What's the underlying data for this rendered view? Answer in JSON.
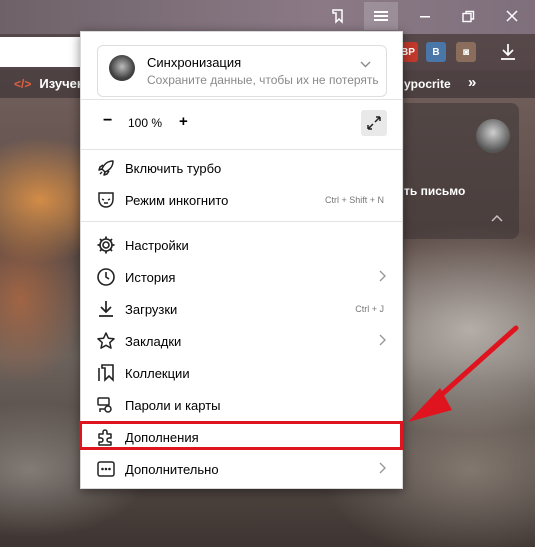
{
  "toolbar": {
    "collections_icon": "collections-icon",
    "menu_icon": "hamburger-menu-icon",
    "minimize_icon": "minimize-icon",
    "restore_icon": "restore-icon",
    "close_icon": "close-icon"
  },
  "extensions": [
    {
      "label": "BP",
      "color": "#c0392b"
    },
    {
      "label": "B",
      "color": "#4a76a8"
    },
    {
      "label": "◙",
      "color": "#8a6d5a"
    }
  ],
  "bookmarks_bar": {
    "left_label": "Изучен",
    "right_label": "ypocrite",
    "more": "»"
  },
  "side_card": {
    "mail_text": "ть письмо"
  },
  "menu": {
    "sync": {
      "title": "Синхронизация",
      "subtitle": "Сохраните данные, чтобы их не потерять"
    },
    "zoom": {
      "minus": "−",
      "value": "100 %",
      "plus": "+"
    },
    "items": [
      {
        "label": "Включить турбо",
        "icon": "rocket-icon"
      },
      {
        "label": "Режим инкогнито",
        "icon": "incognito-mask-icon",
        "shortcut": "Ctrl + Shift + N"
      },
      {
        "label": "Настройки",
        "icon": "gear-icon"
      },
      {
        "label": "История",
        "icon": "clock-icon",
        "submenu": true
      },
      {
        "label": "Загрузки",
        "icon": "download-icon",
        "shortcut": "Ctrl + J"
      },
      {
        "label": "Закладки",
        "icon": "star-icon",
        "submenu": true
      },
      {
        "label": "Коллекции",
        "icon": "collections-icon"
      },
      {
        "label": "Пароли и карты",
        "icon": "key-card-icon"
      },
      {
        "label": "Дополнения",
        "icon": "puzzle-icon",
        "highlighted": true
      },
      {
        "label": "Дополнительно",
        "icon": "more-dots-icon",
        "submenu": true
      }
    ]
  },
  "annotation": {
    "highlight_color": "#e0141e"
  }
}
